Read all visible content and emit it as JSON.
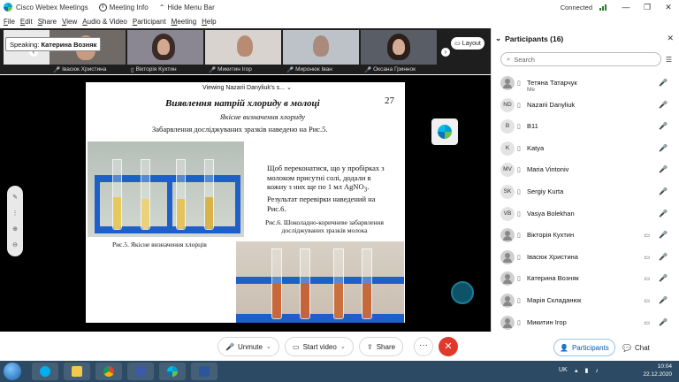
{
  "titlebar": {
    "app_title": "Cisco Webex Meetings",
    "meeting_info": "Meeting Info",
    "hide_menu": "Hide Menu Bar",
    "connection": "Connected",
    "minimize": "—",
    "restore": "❐",
    "close": "✕"
  },
  "menu": [
    "File",
    "Edit",
    "Share",
    "View",
    "Audio & Video",
    "Participant",
    "Meeting",
    "Help"
  ],
  "speaking": {
    "label": "Speaking:",
    "name": "Катерина Возняк"
  },
  "video_tiles": [
    {
      "name": "Івасюк Христина"
    },
    {
      "name": "Вікторія Кухтин"
    },
    {
      "name": "Микитин Ігор"
    },
    {
      "name": "Миронюк Іван"
    },
    {
      "name": "Оксана Гриннок"
    }
  ],
  "layout_label": "Layout",
  "viewing": "Viewing Nazarii Danyliuk's s...",
  "slide": {
    "title": "Виявлення натрій хлориду в молоці",
    "page": "27",
    "subtitle": "Якісне визначення  хлориду",
    "line1": "Забарвлення досліджуваних зразків наведено на Рис.5.",
    "body_a": "Щоб переконатися, що у пробірках з молоком присутні солі, додали в кожну з них ще по 1 мл AgNO",
    "body_sub": "3",
    "body_b": ". Результат перевірки наведений на Рис.6.",
    "caption6": "Рис.6. Шоколадно-коричневе забарвлення досліджуваних зразків молока",
    "caption5": "Рис.5. Якісне визначення хлорців"
  },
  "controls": {
    "unmute": "Unmute",
    "start_video": "Start video",
    "share": "Share",
    "more": "···",
    "participants": "Participants",
    "chat": "Chat"
  },
  "panel": {
    "title": "Participants (16)",
    "search_placeholder": "Search",
    "participants": [
      {
        "initials": "",
        "name": "Тетяна Татарчук",
        "sub": "Me",
        "video": false,
        "mic_on": false,
        "photo": true
      },
      {
        "initials": "ND",
        "name": "Nazarii Danyliuk",
        "sub": "",
        "video": false,
        "mic_on": false,
        "photo": false
      },
      {
        "initials": "B",
        "name": "B11",
        "sub": "",
        "video": false,
        "mic_on": false,
        "photo": false
      },
      {
        "initials": "K",
        "name": "Katya",
        "sub": "",
        "video": false,
        "mic_on": false,
        "photo": false
      },
      {
        "initials": "MV",
        "name": "Maria Vintoniv",
        "sub": "",
        "video": false,
        "mic_on": false,
        "photo": false
      },
      {
        "initials": "SK",
        "name": "Sergiy Kurta",
        "sub": "",
        "video": false,
        "mic_on": false,
        "photo": false
      },
      {
        "initials": "VB",
        "name": "Vasya Bolekhan",
        "sub": "",
        "video": false,
        "mic_on": false,
        "photo": false
      },
      {
        "initials": "",
        "name": "Вікторія Кухтин",
        "sub": "",
        "video": true,
        "mic_on": false,
        "photo": true
      },
      {
        "initials": "",
        "name": "Івасюк Христина",
        "sub": "",
        "video": true,
        "mic_on": false,
        "photo": true
      },
      {
        "initials": "",
        "name": "Катерина Возняк",
        "sub": "",
        "video": true,
        "mic_on": true,
        "photo": true
      },
      {
        "initials": "",
        "name": "Марія Складанюк",
        "sub": "",
        "video": true,
        "mic_on": false,
        "photo": true
      },
      {
        "initials": "",
        "name": "Микитин Ігор",
        "sub": "",
        "video": true,
        "mic_on": false,
        "photo": true
      }
    ]
  },
  "taskbar": {
    "lang": "UK",
    "time": "10:04",
    "date": "22.12.2020"
  }
}
